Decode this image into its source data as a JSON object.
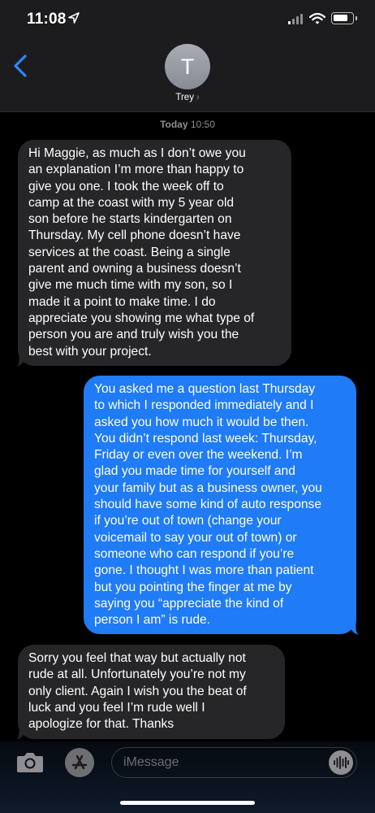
{
  "status": {
    "time": "11:08"
  },
  "header": {
    "avatar_initial": "T",
    "contact_name": "Trey",
    "chevron": "›"
  },
  "thread": {
    "timestamp_day": "Today",
    "timestamp_time": "10:50",
    "messages": [
      {
        "direction": "incoming",
        "lines": [
          "Hi Maggie, as much as I don’t owe you",
          "an explanation I’m more than happy to",
          "give you one. I took the week off to",
          "camp at the coast with my 5 year old",
          "son before he starts kindergarten on",
          "Thursday. My cell phone doesn’t have",
          "services at the coast. Being a single",
          "parent and owning a business doesn’t",
          "give me much time with my son, so I",
          "made it a point to make time. I do",
          "appreciate you showing me what type of",
          "person you are and truly wish you the",
          "best with your project."
        ]
      },
      {
        "direction": "outgoing",
        "lines": [
          "You asked me a question last Thursday",
          "to which I responded immediately and I",
          "asked you how much it would be then.",
          "You didn’t respond last week: Thursday,",
          "Friday or even over the weekend. I’m",
          "glad you made time for yourself and",
          "your family but as a business owner, you",
          "should have some kind of auto response",
          "if you’re out of town (change your",
          "voicemail to say your out of town) or",
          "someone who can respond if you’re",
          "gone. I thought I was more than patient",
          "but you pointing the finger at me by",
          "saying you “appreciate the kind of",
          "person I am” is rude."
        ]
      },
      {
        "direction": "incoming",
        "lines": [
          "Sorry you feel that way but actually not",
          "rude at all. Unfortunately you’re not my",
          "only client. Again I wish you the beat of",
          "luck and you feel I’m rude well I",
          "apologize for that. Thanks"
        ]
      }
    ]
  },
  "composer": {
    "placeholder": "iMessage"
  },
  "icons": {
    "back": "chevron-left-icon",
    "location": "location-arrow-icon",
    "camera": "camera-icon",
    "apps": "app-store-icon",
    "audio": "audio-waveform-icon"
  },
  "colors": {
    "accent": "#1f7bf6",
    "incoming_bubble": "#262628",
    "nav_bg": "#1c1c1e"
  }
}
